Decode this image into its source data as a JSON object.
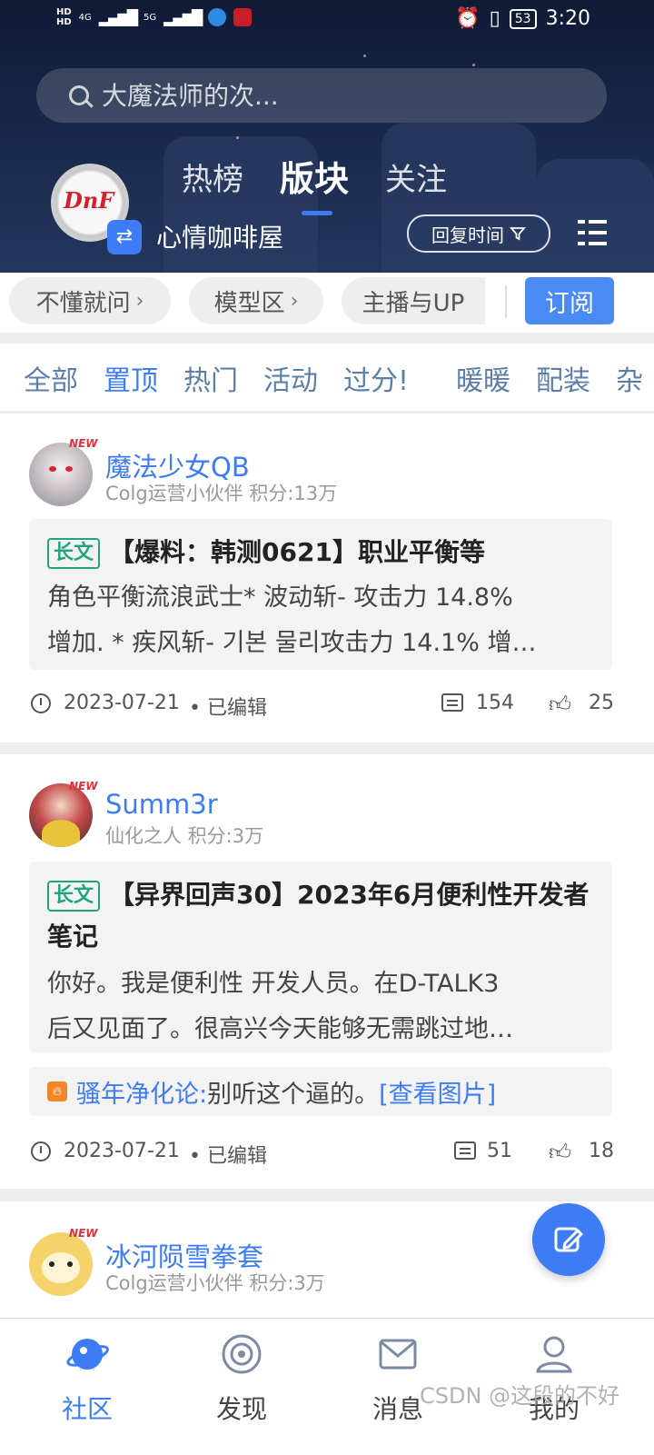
{
  "status_bar": {
    "hd1": "HD",
    "hd2": "HD",
    "net1": "4G",
    "net2": "5G",
    "battery": "53",
    "time": "3:20"
  },
  "search": {
    "placeholder": "大魔法师的次..."
  },
  "header": {
    "tabs": [
      "热榜",
      "版块",
      "关注"
    ],
    "active_tab": "版块",
    "board_name": "心情咖啡屋",
    "board_logo_text": "DnF",
    "sort_label": "回复时间"
  },
  "chips": {
    "items": [
      "不懂就问",
      "模型区",
      "主播与UP"
    ],
    "subscribe_label": "订阅"
  },
  "categories": {
    "items": [
      "全部",
      "置顶",
      "热门",
      "活动",
      "过分!",
      "暖暖",
      "配装",
      "杂"
    ],
    "active": "置顶"
  },
  "posts": [
    {
      "author": "魔法少女QB",
      "meta": "Colg运营小伙伴 积分:13万",
      "new_tag": "NEW",
      "badge": "长文",
      "title": "【爆料：韩测0621】职业平衡等",
      "body_lines": [
        " 角色平衡流浪武士* 波动斩- 攻击力 14.8%",
        "增加. * 疾风斩- 기본 물리攻击力 14.1% 增…"
      ],
      "date": "2023-07-21",
      "edited": "• 已编辑",
      "comments": "154",
      "likes": "25"
    },
    {
      "author": "Summ3r",
      "meta": "仙化之人 积分:3万",
      "new_tag": "NEW",
      "badge": "长文",
      "title": "【异界回声30】2023年6月便利性开发者笔记",
      "body_lines": [
        " 你好。我是便利性 开发人员。在D-TALK3",
        "后又见面了。很高兴今天能够无需跳过地…"
      ],
      "reply": {
        "author": "骚年净化论:",
        "text": " 别听这个逼的。",
        "link": "[查看图片]"
      },
      "date": "2023-07-21",
      "edited": "• 已编辑",
      "comments": "51",
      "likes": "18"
    },
    {
      "author": "冰河陨雪拳套",
      "meta": "Colg运营小伙伴 积分:3万",
      "new_tag": "NEW"
    }
  ],
  "bottom_nav": {
    "items": [
      "社区",
      "发现",
      "消息",
      "我的"
    ],
    "active": "社区"
  },
  "watermark": "CSDN @这段的不好",
  "colors": {
    "accent": "#3d7cf4",
    "badge_green": "#22a57f",
    "header_dark": "#1a2a4d"
  }
}
